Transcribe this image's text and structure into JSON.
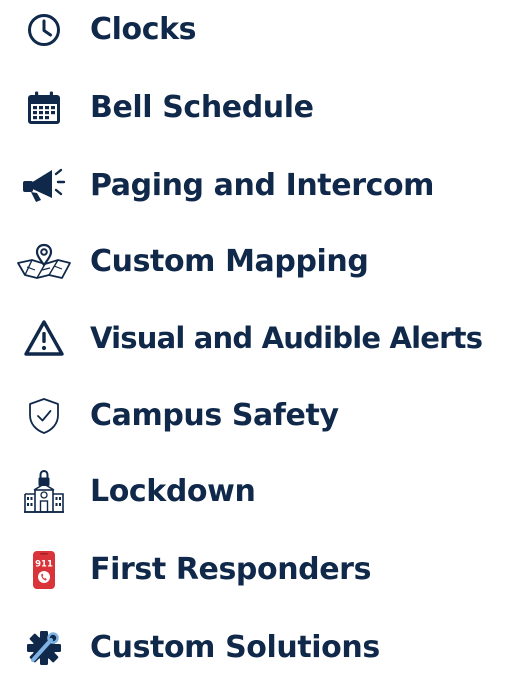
{
  "features": {
    "items": [
      {
        "label": "Clocks",
        "icon": "clock-icon"
      },
      {
        "label": "Bell Schedule",
        "icon": "calendar-icon"
      },
      {
        "label": "Paging and Intercom",
        "icon": "megaphone-icon"
      },
      {
        "label": "Custom Mapping",
        "icon": "map-pin-icon"
      },
      {
        "label": "Visual and Audible Alerts",
        "icon": "warning-triangle-icon"
      },
      {
        "label": "Campus Safety",
        "icon": "shield-check-icon"
      },
      {
        "label": "Lockdown",
        "icon": "locked-building-icon"
      },
      {
        "label": "First Responders",
        "icon": "phone-911-icon",
        "icon_text": "911"
      },
      {
        "label": "Custom Solutions",
        "icon": "gear-wrench-icon"
      }
    ]
  },
  "colors": {
    "text": "#10294a",
    "icon_navy": "#10294a",
    "icon_red": "#d8343a",
    "icon_light_blue": "#7fb3e3"
  }
}
